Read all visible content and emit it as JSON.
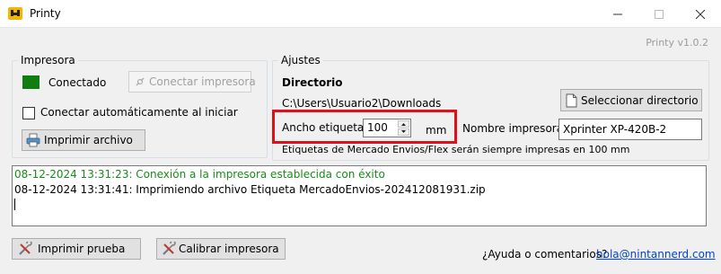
{
  "window": {
    "title": "Printy",
    "version": "Printy v1.0.2"
  },
  "printer_group": {
    "legend": "Impresora",
    "status_text": "Conectado",
    "status_color": "#0f7d0f",
    "connect_button": "Conectar impresora",
    "auto_connect_label": "Conectar automáticamente al iniciar",
    "auto_connect_checked": false,
    "print_file_button": "Imprimir archivo"
  },
  "settings_group": {
    "legend": "Ajustes",
    "directory_title": "Directorio",
    "directory_path": "C:\\Users\\Usuario2\\Downloads",
    "select_directory_button": "Seleccionar directorio",
    "label_width_label": "Ancho etiqueta",
    "label_width_value": "100",
    "label_width_unit": "mm",
    "printer_name_label": "Nombre impresora",
    "printer_name_value": "Xprinter XP-420B-2",
    "note": "Etiquetas de Mercado Envios/Flex serán siempre impresas en 100 mm"
  },
  "log": {
    "lines": [
      "08-12-2024 13:31:23: Conexión a la impresora establecida con éxito",
      "08-12-2024 13:31:41: Imprimiendo archivo Etiqueta MercadoEnvios-202412081931.zip"
    ]
  },
  "footer": {
    "test_print_button": "Imprimir prueba",
    "calibrate_button": "Calibrar impresora",
    "help_text": "¿Ayuda o comentarios?",
    "help_email": "hola@nintannerd.com"
  },
  "colors": {
    "highlight": "#e0101a",
    "success_text": "#1a8a1a",
    "link": "#0044cc"
  }
}
